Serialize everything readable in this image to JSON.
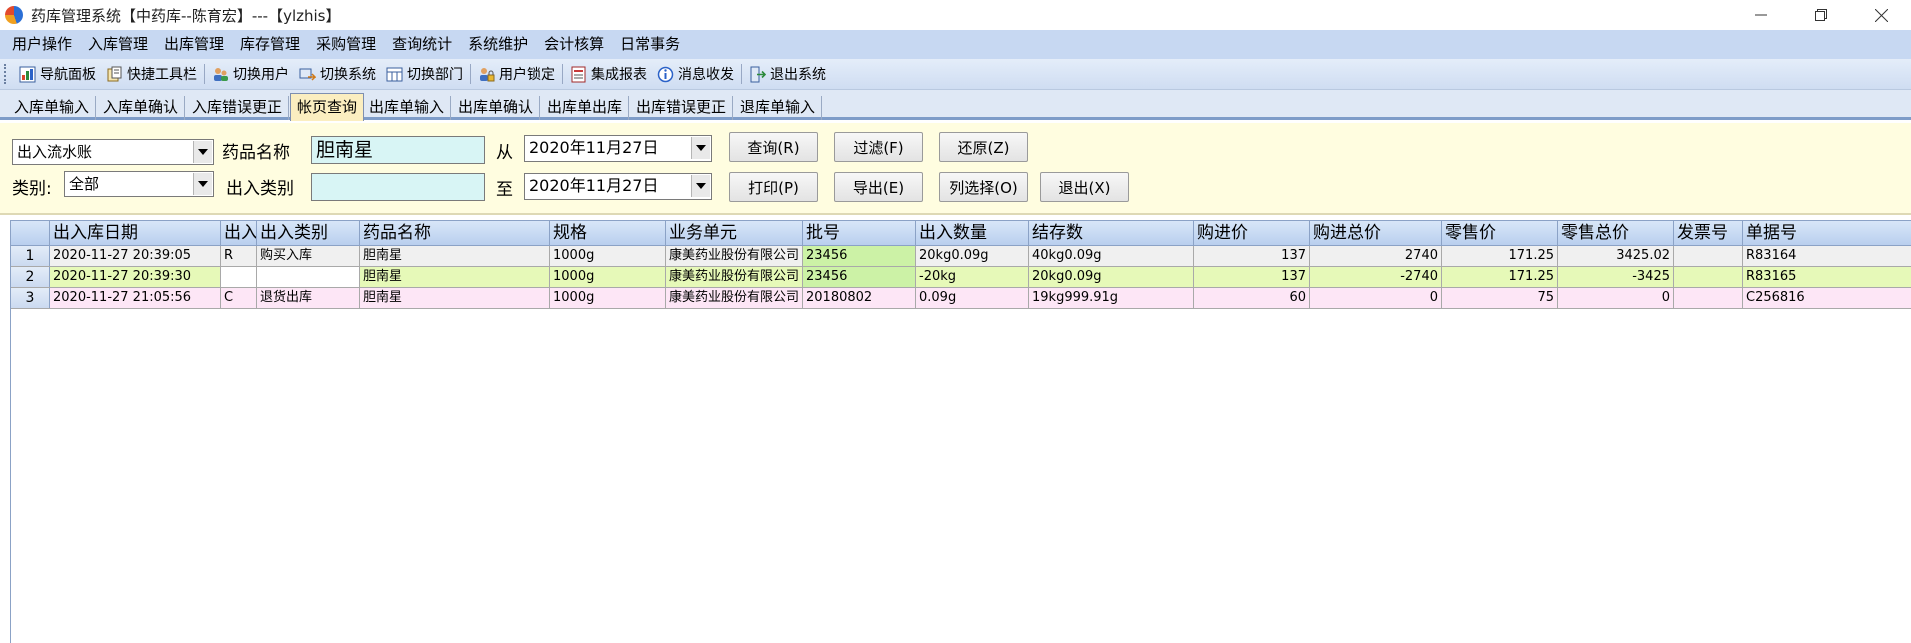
{
  "window": {
    "title": "药库管理系统【中药库--陈育宏】---【ylzhis】"
  },
  "menu": [
    "用户操作",
    "入库管理",
    "出库管理",
    "库存管理",
    "采购管理",
    "查询统计",
    "系统维护",
    "会计核算",
    "日常事务"
  ],
  "toolbar": [
    {
      "label": "导航面板",
      "icon": "navigation-panel-icon"
    },
    {
      "label": "快捷工具栏",
      "icon": "quick-toolbar-icon"
    },
    {
      "label": "切换用户",
      "icon": "switch-user-icon"
    },
    {
      "label": "切换系统",
      "icon": "switch-system-icon"
    },
    {
      "label": "切换部门",
      "icon": "switch-department-icon"
    },
    {
      "label": "用户锁定",
      "icon": "user-lock-icon"
    },
    {
      "label": "集成报表",
      "icon": "report-icon"
    },
    {
      "label": "消息收发",
      "icon": "message-icon"
    },
    {
      "label": "退出系统",
      "icon": "exit-icon"
    }
  ],
  "tabs": [
    {
      "label": "入库单输入"
    },
    {
      "label": "入库单确认"
    },
    {
      "label": "入库错误更正"
    },
    {
      "label": "帐页查询",
      "active": true
    },
    {
      "label": "出库单输入"
    },
    {
      "label": "出库单确认"
    },
    {
      "label": "出库单出库"
    },
    {
      "label": "出库错误更正"
    },
    {
      "label": "退库单输入"
    }
  ],
  "filter": {
    "report_type": "出入流水账",
    "drug_name_label": "药品名称",
    "drug_name_value": "胆南星",
    "from_label": "从",
    "from_date": "2020年11月27日",
    "category_label": "类别:",
    "category_value": "全部",
    "io_type_label": "出入类别",
    "io_type_value": "",
    "to_label": "至",
    "to_date": "2020年11月27日",
    "buttons": {
      "query": "查询(R)",
      "filter": "过滤(F)",
      "restore": "还原(Z)",
      "print": "打印(P)",
      "export": "导出(E)",
      "columns": "列选择(O)",
      "exit": "退出(X)"
    }
  },
  "grid": {
    "columns": [
      "出入库日期",
      "出入",
      "出入类别",
      "药品名称",
      "规格",
      "业务单元",
      "批号",
      "出入数量",
      "结存数",
      "购进价",
      "购进总价",
      "零售价",
      "零售总价",
      "发票号",
      "单据号"
    ],
    "rows": [
      {
        "no": "1",
        "cells": [
          "2020-11-27 20:39:05",
          "R",
          "购买入库",
          "胆南星",
          "1000g",
          "康美药业股份有限公司",
          "23456",
          "20kg0.09g",
          "40kg0.09g",
          "137",
          "2740",
          "171.25",
          "3425.02",
          "",
          "R83164"
        ]
      },
      {
        "no": "2",
        "cells": [
          "2020-11-27 20:39:30",
          "",
          "",
          "胆南星",
          "1000g",
          "康美药业股份有限公司",
          "23456",
          "-20kg",
          "20kg0.09g",
          "137",
          "-2740",
          "171.25",
          "-3425",
          "",
          "R83165"
        ]
      },
      {
        "no": "3",
        "cells": [
          "2020-11-27 21:05:56",
          "C",
          "退货出库",
          "胆南星",
          "1000g",
          "康美药业股份有限公司",
          "20180802",
          "0.09g",
          "19kg999.91g",
          "60",
          "0",
          "75",
          "0",
          "",
          "C256816"
        ]
      }
    ],
    "row_colors": [
      "#f0f0f0",
      "#e6f9b8",
      "#fde6f6"
    ],
    "batch_highlight": "#ccf2a6"
  }
}
